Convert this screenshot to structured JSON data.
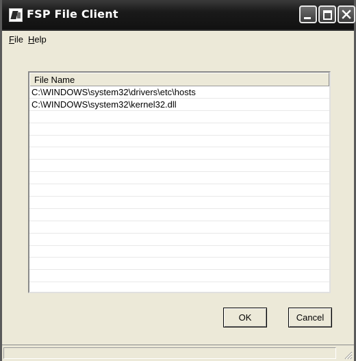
{
  "window": {
    "title": "FSP File Client",
    "icon": "fsp-app-icon"
  },
  "titlebar_buttons": {
    "minimize_icon": "minimize-icon",
    "maximize_icon": "maximize-icon",
    "close_icon": "close-icon"
  },
  "menu": {
    "file": {
      "accel": "F",
      "rest": "ile"
    },
    "help": {
      "accel": "H",
      "rest": "elp"
    }
  },
  "list": {
    "columns": [
      "File Name"
    ],
    "rows": [
      "C:\\WINDOWS\\system32\\drivers\\etc\\hosts",
      "C:\\WINDOWS\\system32\\kernel32.dll"
    ],
    "empty_row_count": 14
  },
  "buttons": {
    "ok": "OK",
    "cancel": "Cancel"
  },
  "statusbar": {
    "text": ""
  }
}
